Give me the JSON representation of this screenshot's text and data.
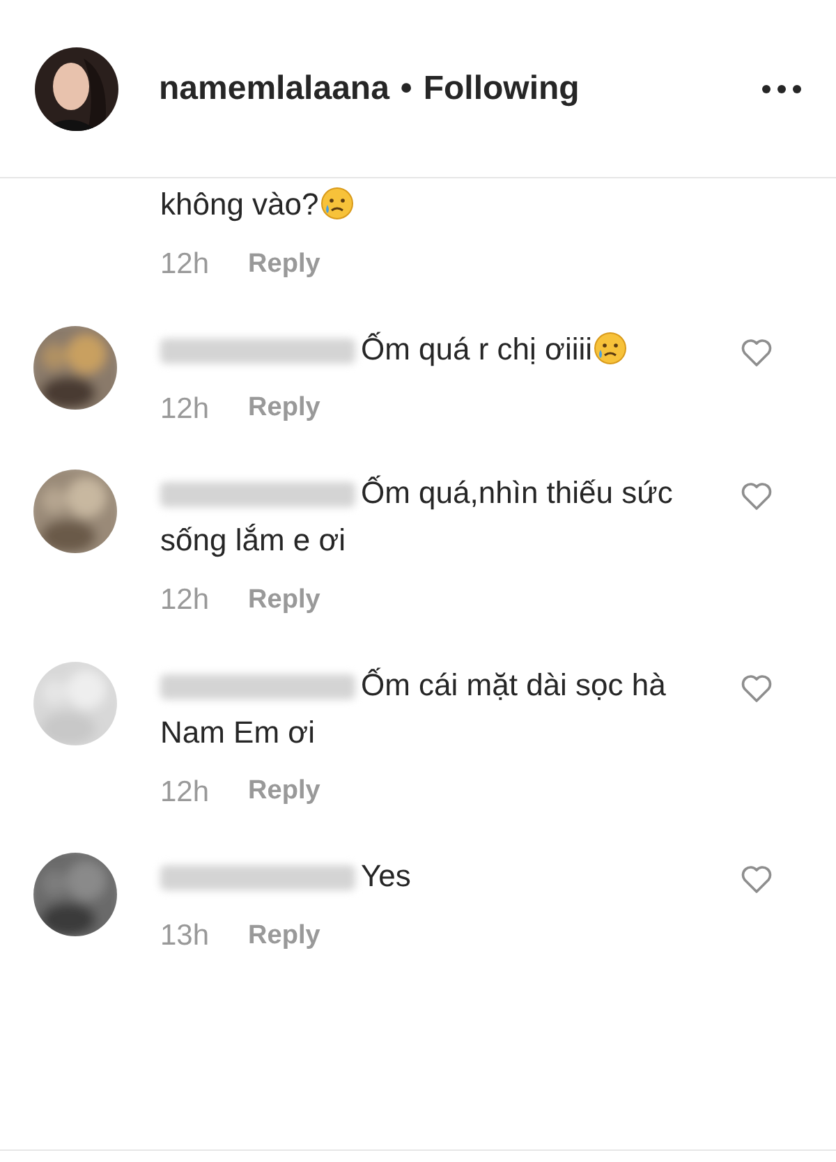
{
  "header": {
    "username": "namemlalaana",
    "separator": "•",
    "follow_status": "Following"
  },
  "comments": [
    {
      "kind": "continuation",
      "text": "không vào?",
      "has_emoji": true,
      "time": "12h",
      "reply": "Reply"
    },
    {
      "kind": "comment",
      "text": "Ốm quá r chị ơiiii",
      "has_emoji": true,
      "time": "12h",
      "reply": "Reply"
    },
    {
      "kind": "comment",
      "text": "Ốm quá,nhìn thiếu sức sống lắm e ơi",
      "has_emoji": false,
      "time": "12h",
      "reply": "Reply"
    },
    {
      "kind": "comment",
      "text": "Ốm cái mặt dài sọc hà Nam Em ơi",
      "has_emoji": false,
      "time": "12h",
      "reply": "Reply"
    },
    {
      "kind": "comment",
      "text": "Yes",
      "has_emoji": false,
      "time": "13h",
      "reply": "Reply"
    }
  ]
}
